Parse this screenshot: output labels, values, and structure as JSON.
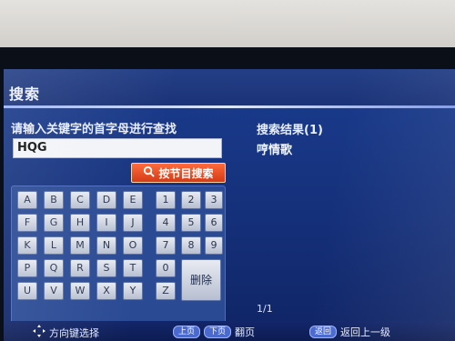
{
  "header": {
    "title": "搜索"
  },
  "search": {
    "prompt": "请输入关键字的首字母进行查找",
    "value": "HQG",
    "button_label": "按节目搜索"
  },
  "keypad": {
    "letters": [
      "A",
      "B",
      "C",
      "D",
      "E",
      "F",
      "G",
      "H",
      "I",
      "J",
      "K",
      "L",
      "M",
      "N",
      "O",
      "P",
      "Q",
      "R",
      "S",
      "T",
      "U",
      "V",
      "W",
      "X",
      "Y",
      "Z"
    ],
    "digits": [
      "1",
      "2",
      "3",
      "4",
      "5",
      "6",
      "7",
      "8",
      "9",
      "0"
    ],
    "delete_label": "删除"
  },
  "results": {
    "title": "搜索结果(1)",
    "items": [
      "哼情歌"
    ],
    "page": "1/1"
  },
  "footer": {
    "nav_hint": "方向键选择",
    "page_up": "上页",
    "page_down": "下页",
    "page_turn": "翻页",
    "back_key": "返回",
    "back_label": "返回上一级"
  },
  "colors": {
    "screen": "#1a3c8e",
    "accent": "#e0481f"
  }
}
